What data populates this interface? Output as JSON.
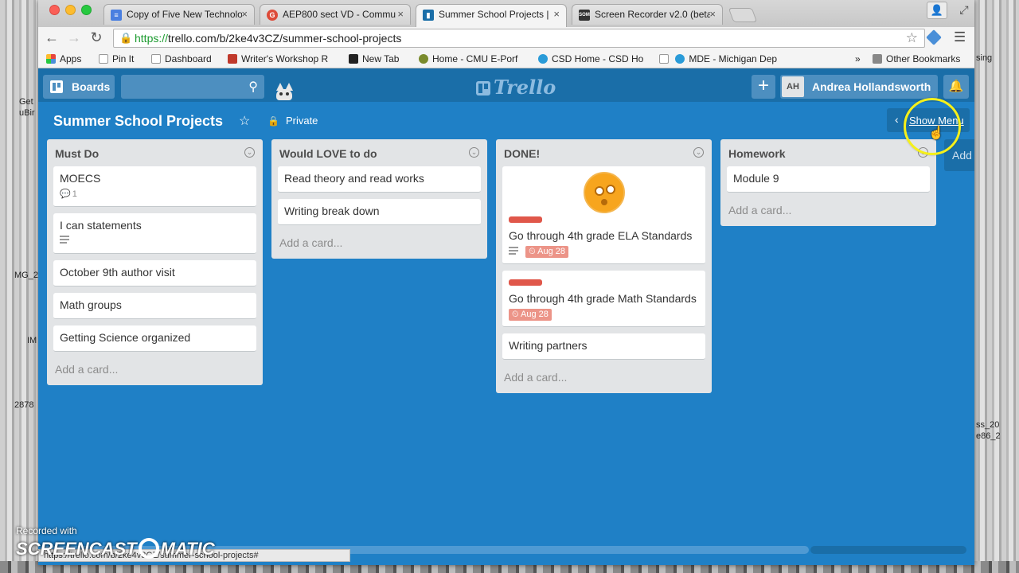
{
  "desktop": {
    "left_labels": [
      "Get",
      "uBir",
      "MG_2",
      "IM",
      "2878"
    ],
    "right_labels": [
      "sing",
      "ss_20",
      "e86_2"
    ]
  },
  "browser": {
    "tabs": [
      {
        "title": "Copy of Five New Technolo",
        "icon": "google-docs-icon",
        "color": "#4a7fe0"
      },
      {
        "title": "AEP800 sect VD - Commu",
        "icon": "google-plus-icon",
        "color": "#dd4b39"
      },
      {
        "title": "Summer School Projects |",
        "icon": "trello-icon",
        "color": "#1a6ea8"
      },
      {
        "title": "Screen Recorder v2.0 (beta",
        "icon": "screencast-icon",
        "color": "#333333"
      }
    ],
    "url_scheme": "https://",
    "url_rest": "trello.com/b/2ke4v3CZ/summer-school-projects",
    "bookmarks": [
      {
        "label": "Apps",
        "icon": "apps-grid-icon",
        "color": "#e8453c"
      },
      {
        "label": "Pin It",
        "icon": "page-icon",
        "color": "#cccccc"
      },
      {
        "label": "Dashboard",
        "icon": "page-icon",
        "color": "#cccccc"
      },
      {
        "label": "Writer's Workshop R",
        "icon": "writer-icon",
        "color": "#c0392b"
      },
      {
        "label": "New Tab",
        "icon": "newtab-icon",
        "color": "#222222"
      },
      {
        "label": "Home - CMU E-Porf",
        "icon": "cmu-icon",
        "color": "#7a8b2d"
      },
      {
        "label": "CSD Home - CSD Ho",
        "icon": "csd-icon",
        "color": "#2a9bd8"
      },
      {
        "label": "MDE - Michigan Dep",
        "icon": "mde-icon",
        "color": "#2a9bd8"
      },
      {
        "label": "Other Bookmarks",
        "icon": "folder-icon",
        "color": "#888888"
      }
    ],
    "overflow_chevron": "»",
    "status_url": "https://trello.com/b/2ke4v3CZ/summer-school-projects#"
  },
  "trello": {
    "boards_label": "Boards",
    "logo_text": "Trello",
    "add_symbol": "+",
    "member_initials": "AH",
    "member_name": "Andrea Hollandsworth",
    "board_title": "Summer School Projects",
    "visibility": "Private",
    "show_menu_label": "Show Menu",
    "add_list_partial": "Add",
    "lists": [
      {
        "title": "Must Do",
        "cards": [
          {
            "title": "MOECS",
            "comments": "1"
          },
          {
            "title": "I can statements",
            "has_description": true
          },
          {
            "title": "October 9th author visit"
          },
          {
            "title": "Math groups"
          },
          {
            "title": "Getting Science organized"
          }
        ],
        "add_card": "Add a card..."
      },
      {
        "title": "Would LOVE to do",
        "cards": [
          {
            "title": "Read theory and read works"
          },
          {
            "title": "Writing break down"
          }
        ],
        "add_card": "Add a card..."
      },
      {
        "title": "DONE!",
        "cards": [
          {
            "title": "Go through 4th grade ELA Standards",
            "label_color": "#e0574a",
            "due": "Aug 28",
            "has_description": true,
            "has_cover": true
          },
          {
            "title": "Go through 4th grade Math Standards",
            "label_color": "#e0574a",
            "due": "Aug 28"
          },
          {
            "title": "Writing partners"
          }
        ],
        "add_card": "Add a card..."
      },
      {
        "title": "Homework",
        "cards": [
          {
            "title": "Module 9"
          }
        ],
        "add_card": "Add a card..."
      }
    ]
  },
  "watermark": {
    "recorded_with": "Recorded with",
    "brand_left": "SCREENCAST",
    "brand_right": "MATIC"
  }
}
